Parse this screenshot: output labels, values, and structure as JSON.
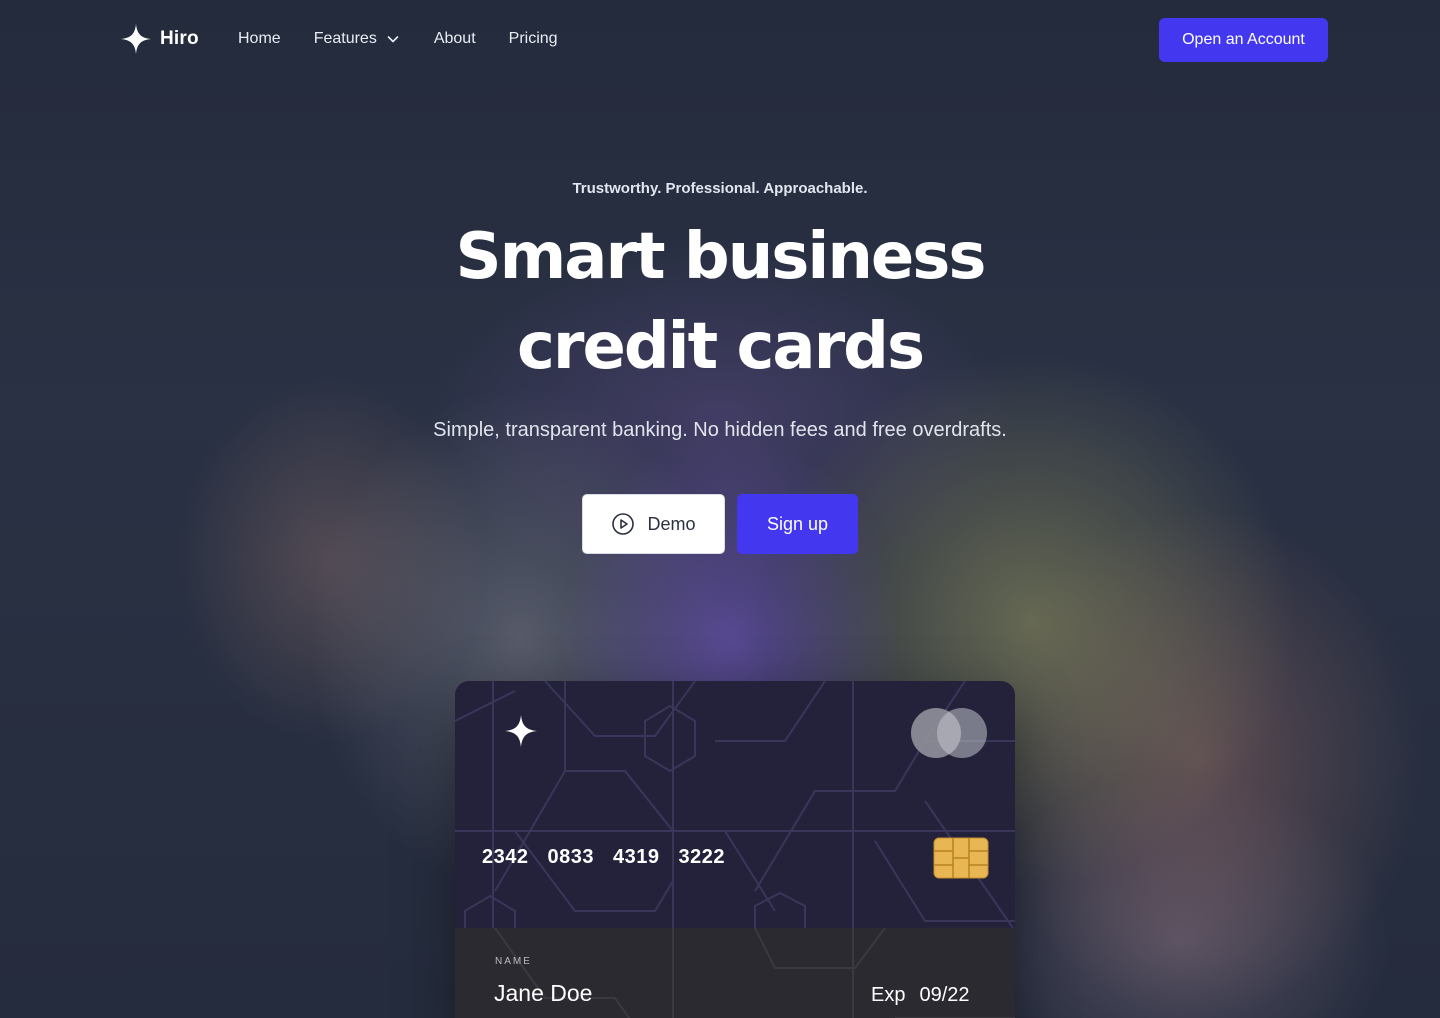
{
  "nav": {
    "logo_text": "Hiro",
    "links": [
      {
        "label": "Home"
      },
      {
        "label": "Features",
        "icon": "chevron-down-icon"
      },
      {
        "label": "About"
      },
      {
        "label": "Pricing"
      }
    ],
    "cta_label": "Open an Account"
  },
  "hero": {
    "tagline": "Trustworthy. Professional. Approachable.",
    "headline_line1": "Smart business",
    "headline_line2": "credit cards",
    "subtitle": "Simple, transparent banking. No hidden fees and free overdrafts.",
    "demo_label": "Demo",
    "demo_icon": "play-circle-icon",
    "signup_label": "Sign up"
  },
  "card": {
    "number_groups": [
      "2342",
      "0833",
      "4319",
      "3222"
    ],
    "name_label": "NAME",
    "holder_name": "Jane Doe",
    "exp_label": "Exp",
    "exp_value": "09/22",
    "icons": [
      "star-logo-icon",
      "card-network-icon",
      "chip-icon"
    ]
  },
  "colors": {
    "accent": "#4338f0",
    "background": "#232b3c",
    "card": "#23223a",
    "chip": "#e9b654"
  }
}
